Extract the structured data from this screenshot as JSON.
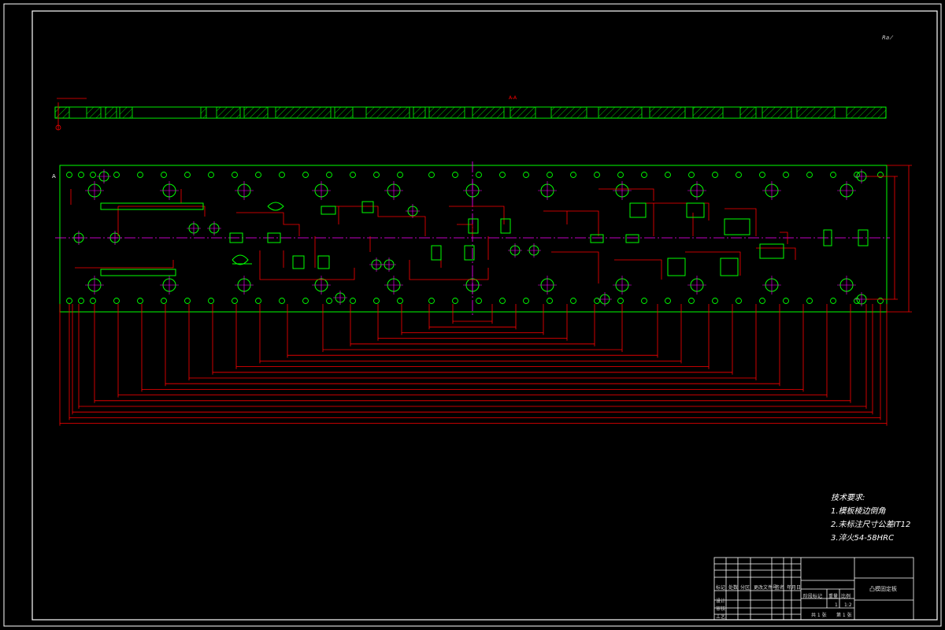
{
  "drawing": {
    "section_label": "A-A",
    "section_marker": "A",
    "corner_note": "Ra ⁄",
    "title": "凸模固定板",
    "sheet_count": "1",
    "scale": "1:2"
  },
  "notes": {
    "heading": "技术要求:",
    "items": [
      "1.模板棱边倒角",
      "2.未标注尺寸公差IT12",
      "3.淬火54-58HRC"
    ]
  },
  "title_block": {
    "row_labels": [
      "标记",
      "处数",
      "分区",
      "更改文件号",
      "签名",
      "年月日"
    ],
    "left_labels": [
      "设计",
      "审核",
      "工艺"
    ],
    "mid_labels": [
      "阶段标记",
      "重量",
      "比例"
    ],
    "bottom_labels": [
      "共 1 张",
      "第 1 张"
    ]
  },
  "colors": {
    "frame": "#ffffff",
    "outline": "#00ff00",
    "dimension": "#ff0000",
    "centerline": "#ff00ff",
    "hatch": "#00ff00"
  }
}
